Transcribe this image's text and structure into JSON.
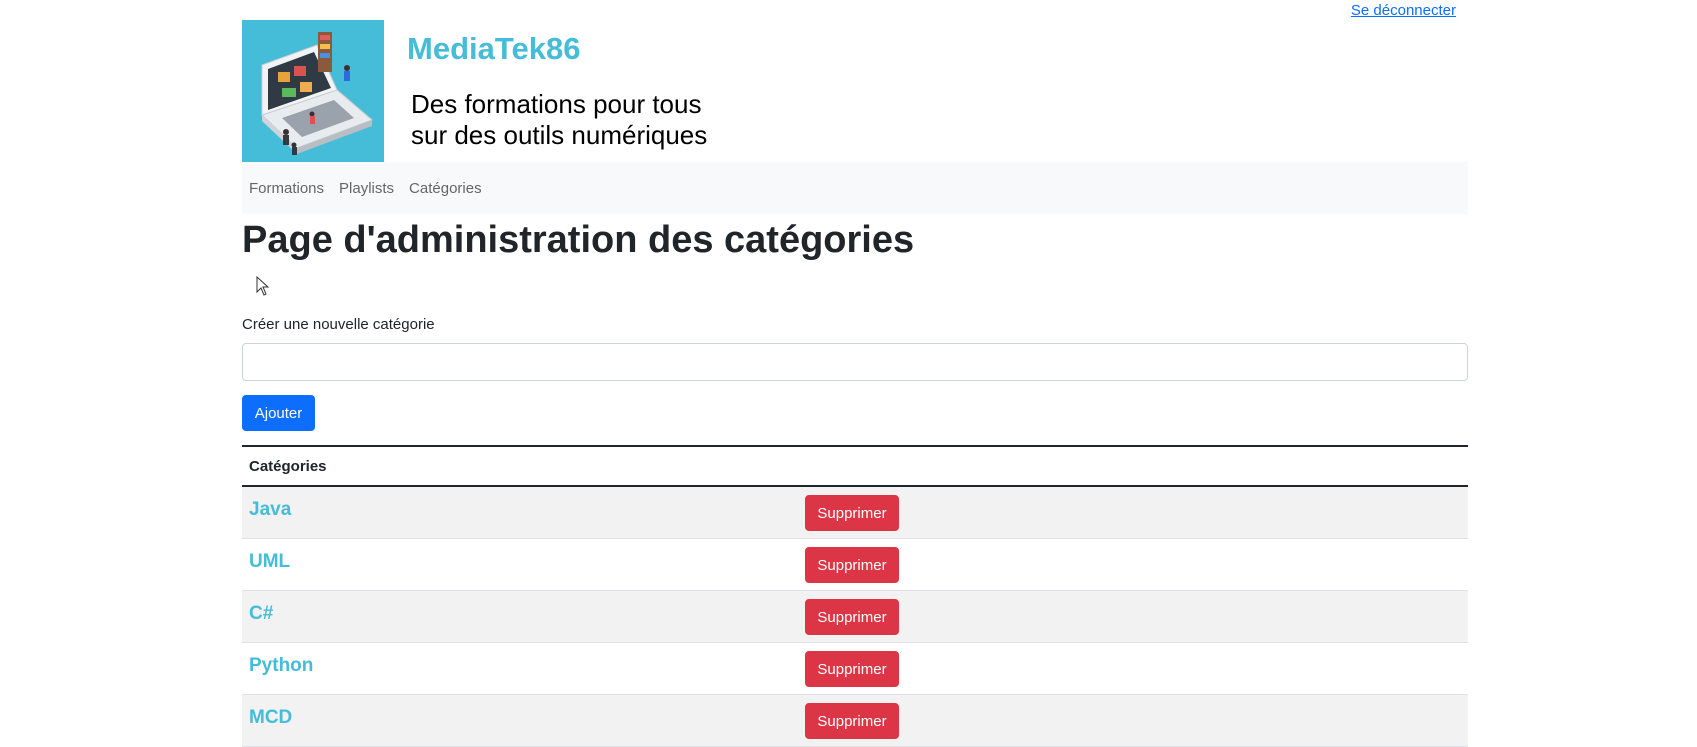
{
  "header": {
    "logout_label": "Se déconnecter",
    "site_title": "MediaTek86",
    "tagline_line1": "Des formations pour tous",
    "tagline_line2": "sur des outils numériques"
  },
  "nav": {
    "items": [
      {
        "label": "Formations"
      },
      {
        "label": "Playlists"
      },
      {
        "label": "Catégories"
      }
    ]
  },
  "main": {
    "page_title": "Page d'administration des catégories",
    "form": {
      "label": "Créer une nouvelle catégorie",
      "input_value": "",
      "submit_label": "Ajouter"
    },
    "table": {
      "header": "Catégories",
      "delete_label": "Supprimer",
      "rows": [
        {
          "name": "Java"
        },
        {
          "name": "UML"
        },
        {
          "name": "C#"
        },
        {
          "name": "Python"
        },
        {
          "name": "MCD"
        }
      ]
    }
  },
  "colors": {
    "brand": "#45bcd8",
    "primary": "#0d6efd",
    "danger": "#dc3545",
    "navbar_bg": "#f8f9fa"
  },
  "icons": {
    "logo": "laptop-illustration-logo",
    "cursor": "mouse-pointer-icon"
  }
}
